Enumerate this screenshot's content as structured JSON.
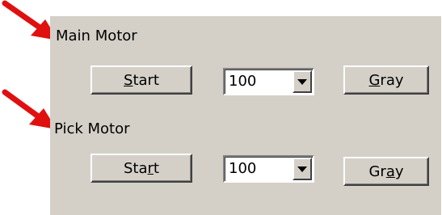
{
  "annotation": {
    "arrow_color": "#e01010",
    "arrow_icon": "red-arrow-icon"
  },
  "panel": {
    "background": "#d4d0c8"
  },
  "main_motor": {
    "label": "Main Motor",
    "start_accel": "S",
    "start_rest": "tart",
    "speed_value": "100",
    "gray_accel": "G",
    "gray_rest": "ray"
  },
  "pick_motor": {
    "label": "Pick Motor",
    "start_pre": "Sta",
    "start_accel": "r",
    "start_rest": "t",
    "speed_value": "100",
    "gray_pre": "Gr",
    "gray_accel": "a",
    "gray_rest": "y"
  }
}
